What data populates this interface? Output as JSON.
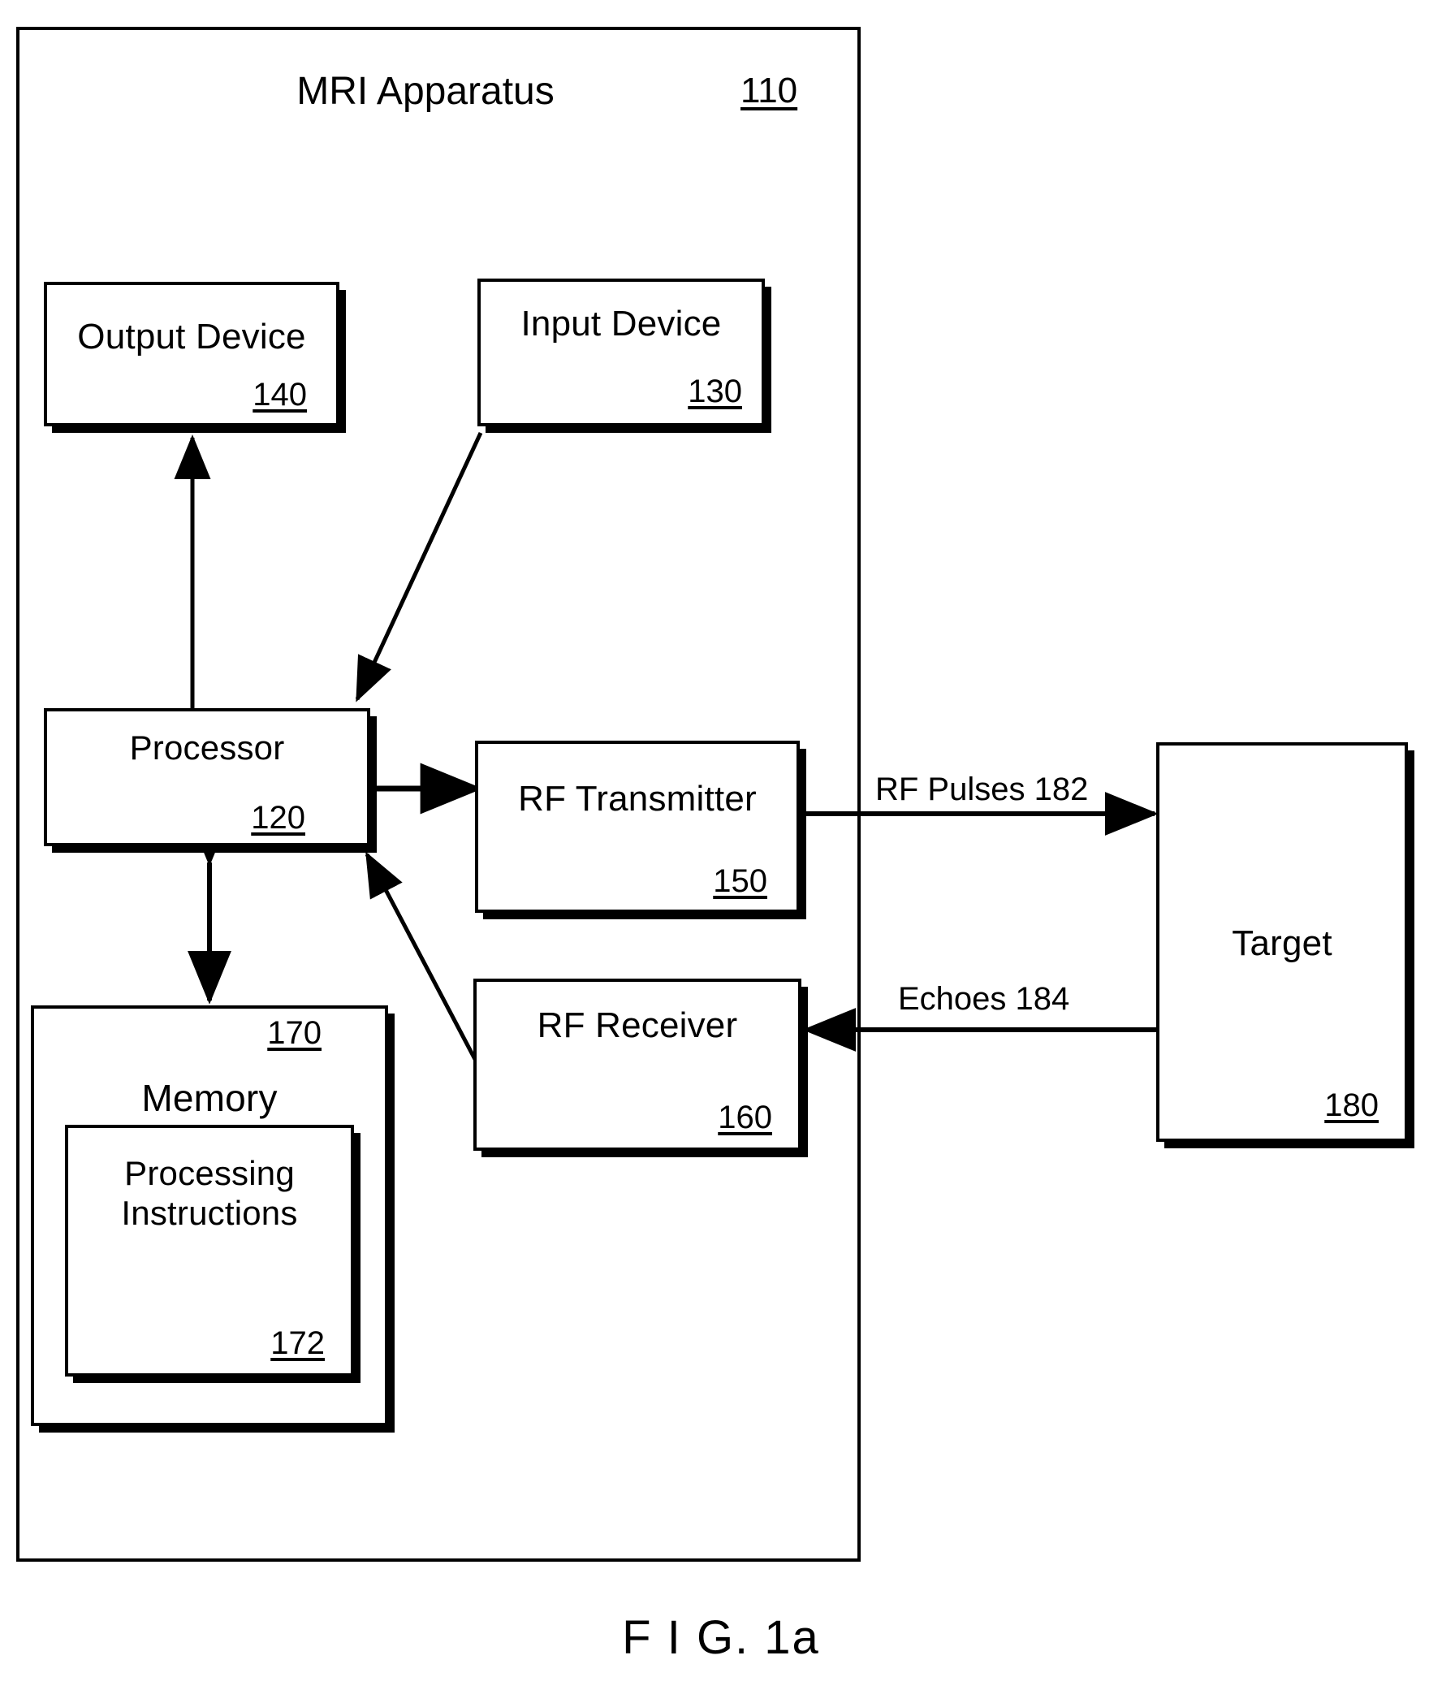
{
  "figure": {
    "caption": "F I G. 1a"
  },
  "apparatus": {
    "title": "MRI Apparatus",
    "ref": "110"
  },
  "blocks": {
    "output_device": {
      "title": "Output Device",
      "ref": "140"
    },
    "input_device": {
      "title": "Input Device",
      "ref": "130"
    },
    "processor": {
      "title": "Processor",
      "ref": "120"
    },
    "rf_transmitter": {
      "title": "RF Transmitter",
      "ref": "150"
    },
    "rf_receiver": {
      "title": "RF Receiver",
      "ref": "160"
    },
    "memory": {
      "title": "Memory",
      "ref": "170"
    },
    "processing_instructions": {
      "title": "Processing\nInstructions",
      "ref": "172"
    },
    "target": {
      "title": "Target",
      "ref": "180"
    }
  },
  "signals": {
    "rf_pulses": "RF Pulses 182",
    "echoes": "Echoes 184"
  },
  "colors": {
    "ink": "#000000",
    "paper": "#ffffff"
  }
}
